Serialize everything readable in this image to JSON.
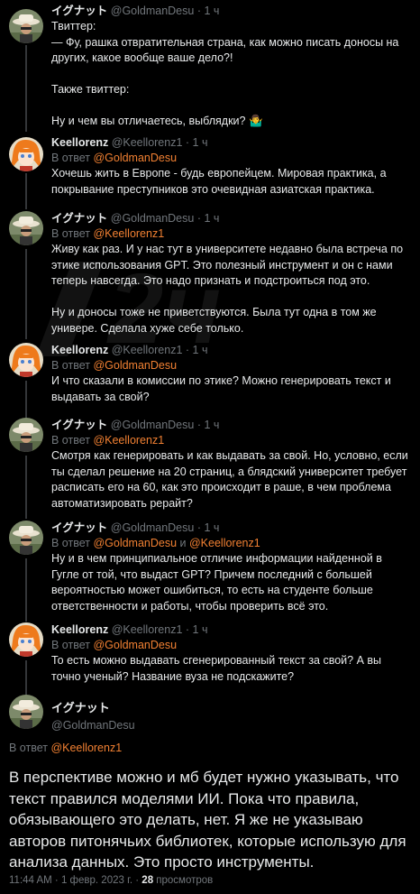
{
  "tweets": [
    {
      "name": "イグナット",
      "handle": "@GoldmanDesu",
      "time": "· 1 ч",
      "reply_prefix": "",
      "reply_to": "",
      "reply_and": "",
      "reply_to2": "",
      "text": "Твиттер:\n— Фу, рашка отвратительная страна, как можно писать доносы на других, какое вообще ваше дело?!\n\nТакже твиттер:\n\nНу и чем вы отличаетесь, выблядки? 🤷‍♂️",
      "avatar": "cowboy"
    },
    {
      "name": "Keellorenz",
      "handle": "@Keellorenz1",
      "time": "· 1 ч",
      "reply_prefix": "В ответ ",
      "reply_to": "@GoldmanDesu",
      "reply_and": "",
      "reply_to2": "",
      "text": "Хочешь жить в Европе - будь европейцем. Мировая практика, а покрывание преступников это очевидная азиатская практика.",
      "avatar": "anime"
    },
    {
      "name": "イグナット",
      "handle": "@GoldmanDesu",
      "time": "· 1 ч",
      "reply_prefix": "В ответ ",
      "reply_to": "@Keellorenz1",
      "reply_and": "",
      "reply_to2": "",
      "text": "Живу как раз. И у нас тут в университете недавно была встреча по этике использования GPT. Это полезный инструмент и он с нами теперь навсегда. Это надо признать и подстроиться под это.\n\nНу и доносы тоже не приветствуются. Была тут одна в том же универе. Сделала хуже себе только.",
      "avatar": "cowboy"
    },
    {
      "name": "Keellorenz",
      "handle": "@Keellorenz1",
      "time": "· 1 ч",
      "reply_prefix": "В ответ ",
      "reply_to": "@GoldmanDesu",
      "reply_and": "",
      "reply_to2": "",
      "text": "И что сказали в комиссии по этике? Можно генерировать текст и выдавать за свой?",
      "avatar": "anime"
    },
    {
      "name": "イグナット",
      "handle": "@GoldmanDesu",
      "time": "· 1 ч",
      "reply_prefix": "В ответ ",
      "reply_to": "@Keellorenz1",
      "reply_and": "",
      "reply_to2": "",
      "text": "Смотря как генерировать и как выдавать за свой. Но, условно, если ты сделал решение на 20 страниц, а блядский университет требует расписать его на 60, как это происходит в раше, в чем проблема автоматизировать рерайт?",
      "avatar": "cowboy"
    },
    {
      "name": "イグナット",
      "handle": "@GoldmanDesu",
      "time": "· 1 ч",
      "reply_prefix": "В ответ ",
      "reply_to": "@GoldmanDesu",
      "reply_and": " и ",
      "reply_to2": "@Keellorenz1",
      "text": "Ну и в чем принципиальное отличие информации найденной в Гугле от той, что выдаст GPT? Причем последний с большей вероятностью может ошибиться, то есть на студенте больше ответственности и работы, чтобы проверить всё это.",
      "avatar": "cowboy"
    },
    {
      "name": "Keellorenz",
      "handle": "@Keellorenz1",
      "time": "· 1 ч",
      "reply_prefix": "В ответ ",
      "reply_to": "@GoldmanDesu",
      "reply_and": "",
      "reply_to2": "",
      "text": "То есть можно выдавать сгенерированный текст за свой? А вы точно ученый? Название вуза не подскажите?",
      "avatar": "anime"
    }
  ],
  "main": {
    "name": "イグナット",
    "handle": "@GoldmanDesu",
    "reply_prefix": "В ответ ",
    "reply_to": "@Keellorenz1",
    "text": "В перспективе можно и мб будет нужно указывать, что текст правился моделями ИИ. Пока что правила, обязывающего это делать, нет. Я же не указываю авторов питонячьих библиотек, которые использую для анализа данных. Это просто инструменты.",
    "time": "11:44 AM · 1 февр. 2023 г. · ",
    "views_count": "28",
    "views_label": " просмотров"
  },
  "colors": {
    "background": "#000000",
    "text": "#e7e9ea",
    "muted": "#71767b",
    "mention": "#f18032"
  }
}
